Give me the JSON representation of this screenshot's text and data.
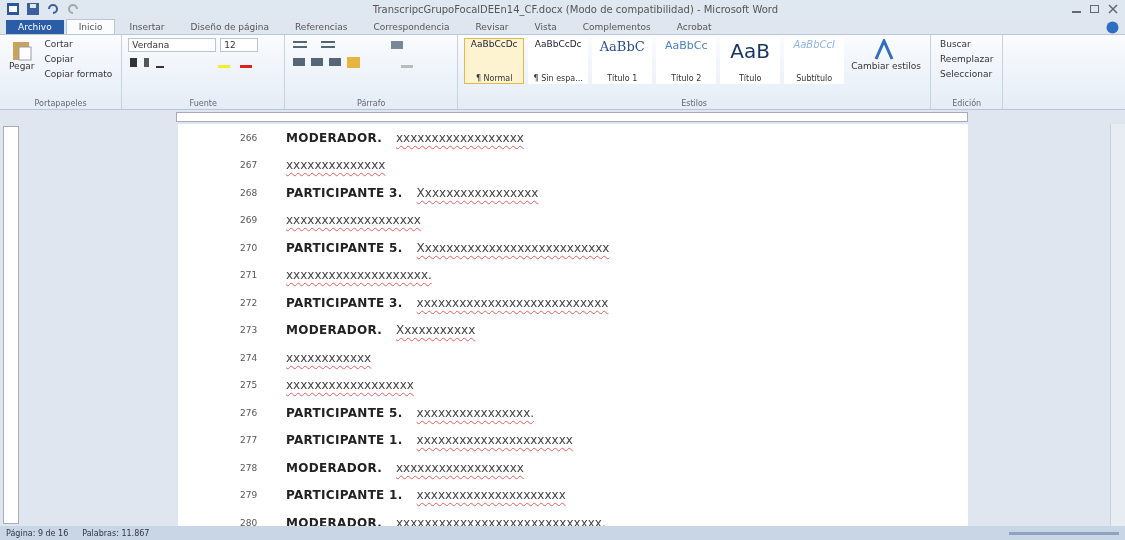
{
  "window": {
    "title": "TranscripcGrupoFocalDEEn14_CF.docx (Modo de compatibilidad) - Microsoft Word"
  },
  "ribbon_tabs": [
    {
      "label": "Archivo",
      "kind": "file",
      "selected": false
    },
    {
      "label": "Inicio",
      "kind": "tab",
      "selected": true
    },
    {
      "label": "Insertar",
      "kind": "tab",
      "selected": false
    },
    {
      "label": "Diseño de página",
      "kind": "tab",
      "selected": false
    },
    {
      "label": "Referencias",
      "kind": "tab",
      "selected": false
    },
    {
      "label": "Correspondencia",
      "kind": "tab",
      "selected": false
    },
    {
      "label": "Revisar",
      "kind": "tab",
      "selected": false
    },
    {
      "label": "Vista",
      "kind": "tab",
      "selected": false
    },
    {
      "label": "Complementos",
      "kind": "tab",
      "selected": false
    },
    {
      "label": "Acrobat",
      "kind": "tab",
      "selected": false
    }
  ],
  "clipboard": {
    "paste": "Pegar",
    "cut": "Cortar",
    "copy": "Copiar",
    "format_painter": "Copiar formato",
    "group": "Portapapeles"
  },
  "font": {
    "family": "Verdana",
    "size": "12",
    "group": "Fuente"
  },
  "paragraph": {
    "group": "Párrafo"
  },
  "styles": {
    "group": "Estilos",
    "items": [
      {
        "sample": "AaBbCcDc",
        "label": "¶ Normal",
        "kind": "normal",
        "selected": true
      },
      {
        "sample": "AaBbCcDc",
        "label": "¶ Sin espa...",
        "kind": "normal",
        "selected": false
      },
      {
        "sample": "AaBbC",
        "label": "Título 1",
        "kind": "heading1",
        "selected": false
      },
      {
        "sample": "AaBbCc",
        "label": "Título 2",
        "kind": "heading2",
        "selected": false
      },
      {
        "sample": "AaB",
        "label": "Título",
        "kind": "title",
        "selected": false
      },
      {
        "sample": "AaBbCcI",
        "label": "Subtítulo",
        "kind": "subtitle",
        "selected": false
      }
    ],
    "change": "Cambiar estilos"
  },
  "editing": {
    "group": "Edición",
    "items": [
      "Buscar",
      "Reemplazar",
      "Seleccionar"
    ]
  },
  "document": {
    "lines": [
      {
        "number": "266",
        "speaker": "MODERADOR.",
        "text": "xxxxxxxxxxxxxxxxxx"
      },
      {
        "number": "267",
        "text": "xxxxxxxxxxxxxx"
      },
      {
        "number": "268",
        "speaker": "PARTICIPANTE 3.",
        "text": "Xxxxxxxxxxxxxxxxx"
      },
      {
        "number": "269",
        "text": "xxxxxxxxxxxxxxxxxxx"
      },
      {
        "number": "270",
        "speaker": "PARTICIPANTE 5.",
        "text": "Xxxxxxxxxxxxxxxxxxxxxxxxxxx"
      },
      {
        "number": "271",
        "text": "xxxxxxxxxxxxxxxxxxxx."
      },
      {
        "number": "272",
        "speaker": "PARTICIPANTE 3.",
        "text": "xxxxxxxxxxxxxxxxxxxxxxxxxxx"
      },
      {
        "number": "273",
        "speaker": "MODERADOR.",
        "text": "Xxxxxxxxxxx"
      },
      {
        "number": "274",
        "text": "xxxxxxxxxxxx"
      },
      {
        "number": "275",
        "text": "xxxxxxxxxxxxxxxxxx"
      },
      {
        "number": "276",
        "speaker": "PARTICIPANTE 5.",
        "text": "xxxxxxxxxxxxxxxx."
      },
      {
        "number": "277",
        "speaker": "PARTICIPANTE 1.",
        "text": "xxxxxxxxxxxxxxxxxxxxxx"
      },
      {
        "number": "278",
        "speaker": "MODERADOR.",
        "text": "xxxxxxxxxxxxxxxxxx"
      },
      {
        "number": "279",
        "speaker": "PARTICIPANTE 1.",
        "text": "xxxxxxxxxxxxxxxxxxxxx"
      },
      {
        "number": "280",
        "speaker": "MODERADOR.",
        "text": "xxxxxxxxxxxxxxxxxxxxxxxxxxxxx."
      }
    ]
  },
  "status_bar": {
    "page": "Página: 9 de 16",
    "words": "Palabras: 11.867"
  }
}
